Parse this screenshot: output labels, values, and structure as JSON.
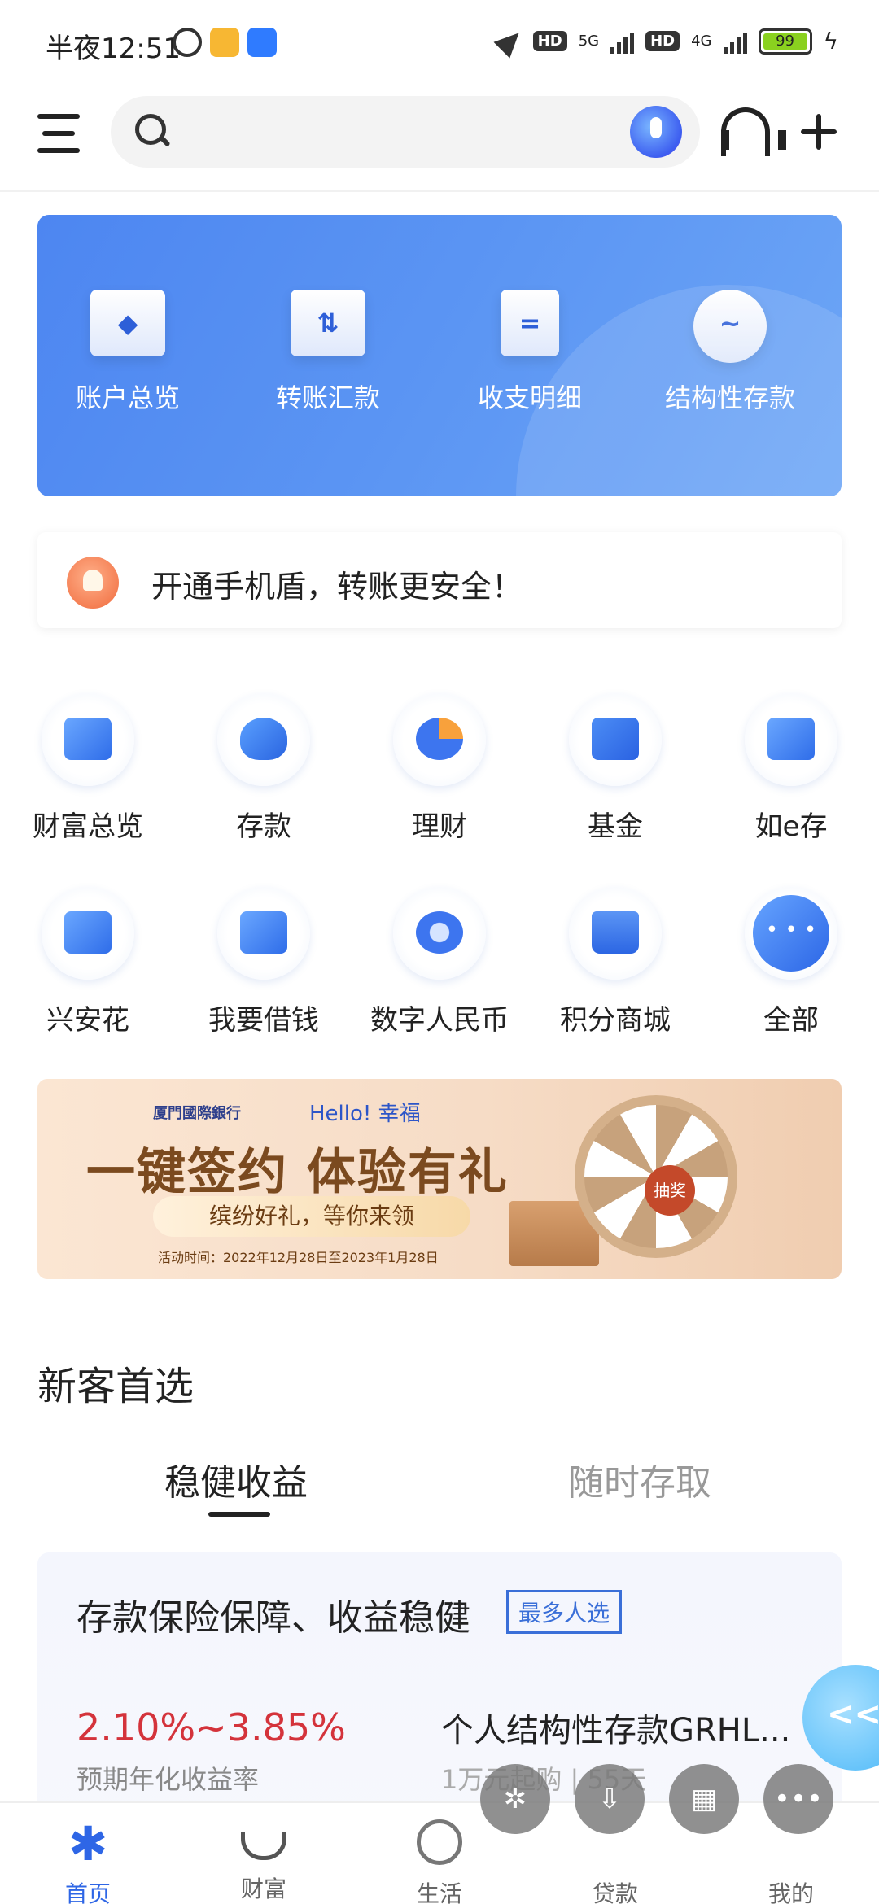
{
  "status_bar": {
    "time": "半夜12:51",
    "battery": "99",
    "net1": "5G",
    "net2": "4G",
    "hd": "HD"
  },
  "header": {
    "search_placeholder": ""
  },
  "quick_actions": [
    {
      "label": "账户总览",
      "icon": "wallet-icon",
      "glyph": "◆"
    },
    {
      "label": "转账汇款",
      "icon": "transfer-icon",
      "glyph": "⇅"
    },
    {
      "label": "收支明细",
      "icon": "statement-icon",
      "glyph": "="
    },
    {
      "label": "结构性存款",
      "icon": "wave-icon",
      "glyph": "~"
    }
  ],
  "notice": {
    "text": "开通手机盾，转账更安全！"
  },
  "services": [
    {
      "label": "财富总览",
      "icon": "wealth-overview-icon"
    },
    {
      "label": "存款",
      "icon": "piggy-bank-icon"
    },
    {
      "label": "理财",
      "icon": "pie-chart-icon"
    },
    {
      "label": "基金",
      "icon": "fund-chart-icon"
    },
    {
      "label": "如e存",
      "icon": "puzzle-icon"
    },
    {
      "label": "兴安花",
      "icon": "document-icon"
    },
    {
      "label": "我要借钱",
      "icon": "loan-icon"
    },
    {
      "label": "数字人民币",
      "icon": "digital-rmb-icon"
    },
    {
      "label": "积分商城",
      "icon": "shopping-bag-icon"
    },
    {
      "label": "全部",
      "icon": "more-icon"
    }
  ],
  "promo": {
    "bank_name": "厦門國際銀行",
    "hello": "Hello! 幸福",
    "title": "一键签约 体验有礼",
    "pill": "缤纷好礼，等你来领",
    "date": "活动时间：2022年12月28日至2023年1月28日",
    "wheel_label": "抽奖"
  },
  "new_customer": {
    "title": "新客首选",
    "tabs": [
      "稳健收益",
      "随时存取"
    ],
    "card": {
      "headline": "存款保险保障、收益稳健",
      "badge": "最多人选",
      "rate": "2.10%~3.85%",
      "rate_label": "预期年化收益率",
      "product_name": "个人结构性存款GRHL...",
      "product_meta": "1万元起购 | 55天"
    }
  },
  "bottom_nav": [
    {
      "label": "首页",
      "active": true
    },
    {
      "label": "财富",
      "active": false
    },
    {
      "label": "生活",
      "active": false
    },
    {
      "label": "贷款",
      "active": false
    },
    {
      "label": "我的",
      "active": false
    }
  ],
  "colors": {
    "accent": "#2e66e6",
    "rate": "#d4333b"
  }
}
